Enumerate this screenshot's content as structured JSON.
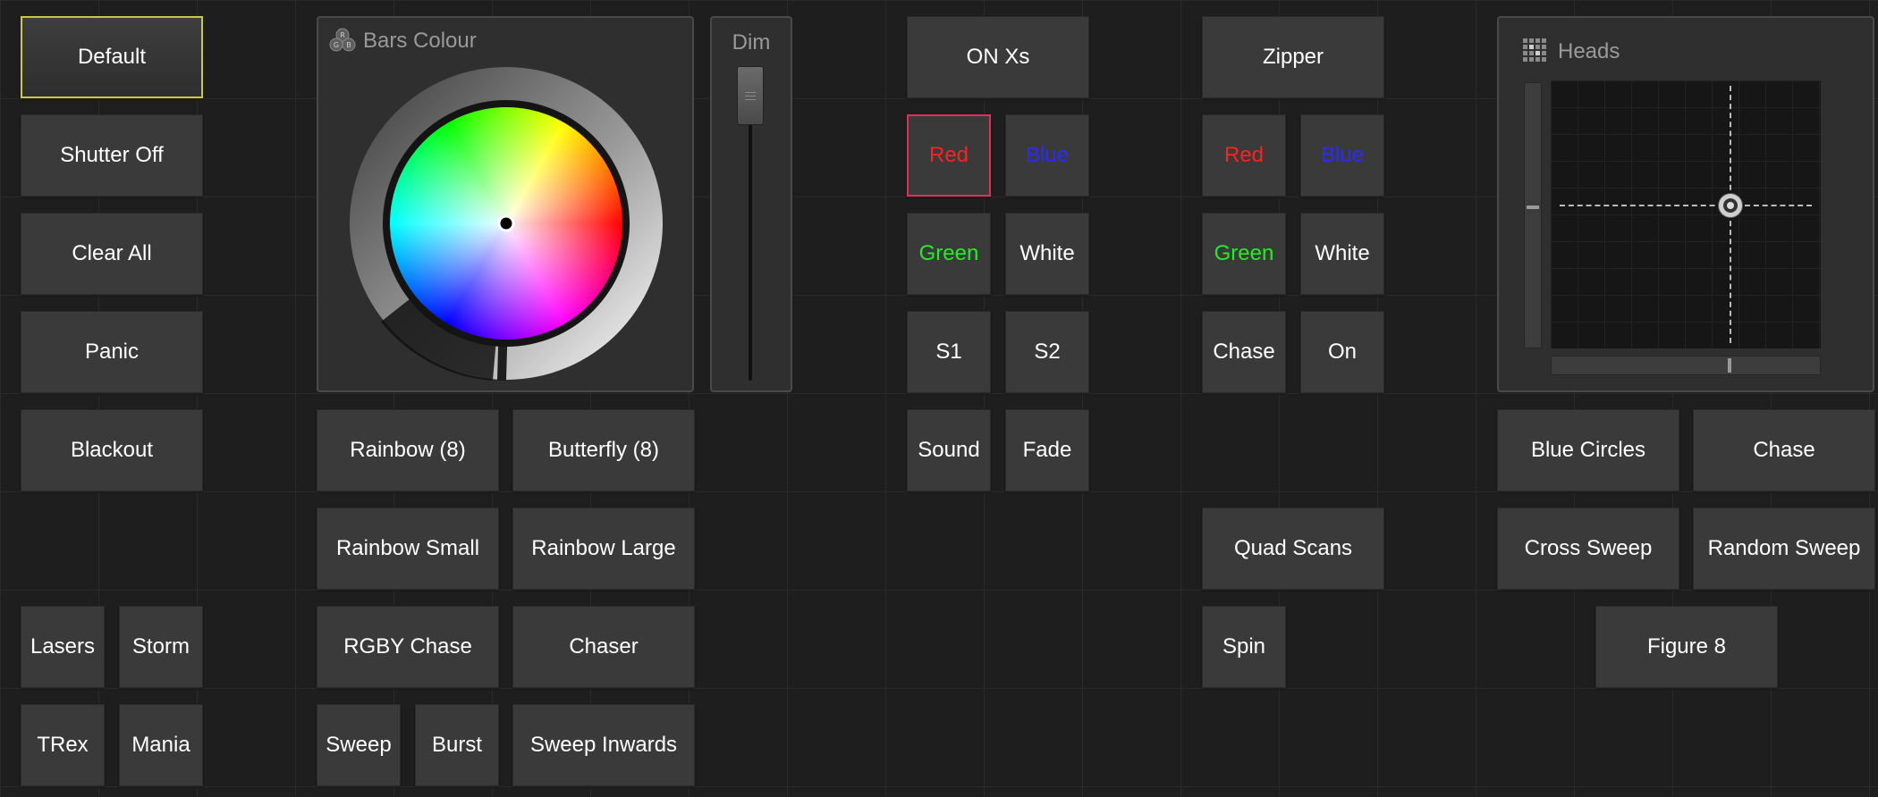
{
  "colors": {
    "red": "#ff2020",
    "blue": "#2a2aff",
    "green": "#22ee22",
    "white": "#ffffff",
    "default_border": "#c8c84a",
    "selected_border": "#e0305a"
  },
  "left": {
    "default": "Default",
    "shutter_off": "Shutter Off",
    "clear_all": "Clear All",
    "panic": "Panic",
    "blackout": "Blackout",
    "lasers": "Lasers",
    "storm": "Storm",
    "trex": "TRex",
    "mania": "Mania"
  },
  "bars": {
    "title": "Bars Colour",
    "icon": "rgb-icon",
    "rainbow8": "Rainbow (8)",
    "butterfly8": "Butterfly (8)",
    "rainbow_small": "Rainbow Small",
    "rainbow_large": "Rainbow Large",
    "rgby_chase": "RGBY Chase",
    "chaser": "Chaser",
    "sweep": "Sweep",
    "burst": "Burst",
    "sweep_inwards": "Sweep Inwards"
  },
  "dim": {
    "title": "Dim"
  },
  "on_xs": {
    "title": "ON Xs",
    "red": "Red",
    "blue": "Blue",
    "green": "Green",
    "white": "White",
    "s1": "S1",
    "s2": "S2",
    "sound": "Sound",
    "fade": "Fade"
  },
  "zipper": {
    "title": "Zipper",
    "red": "Red",
    "blue": "Blue",
    "green": "Green",
    "white": "White",
    "chase": "Chase",
    "on": "On",
    "quad_scans": "Quad Scans",
    "spin": "Spin"
  },
  "heads": {
    "title": "Heads",
    "icon": "grid-icon",
    "blue_circles": "Blue Circles",
    "chase": "Chase",
    "cross_sweep": "Cross Sweep",
    "random_sweep": "Random Sweep",
    "figure8": "Figure 8"
  }
}
